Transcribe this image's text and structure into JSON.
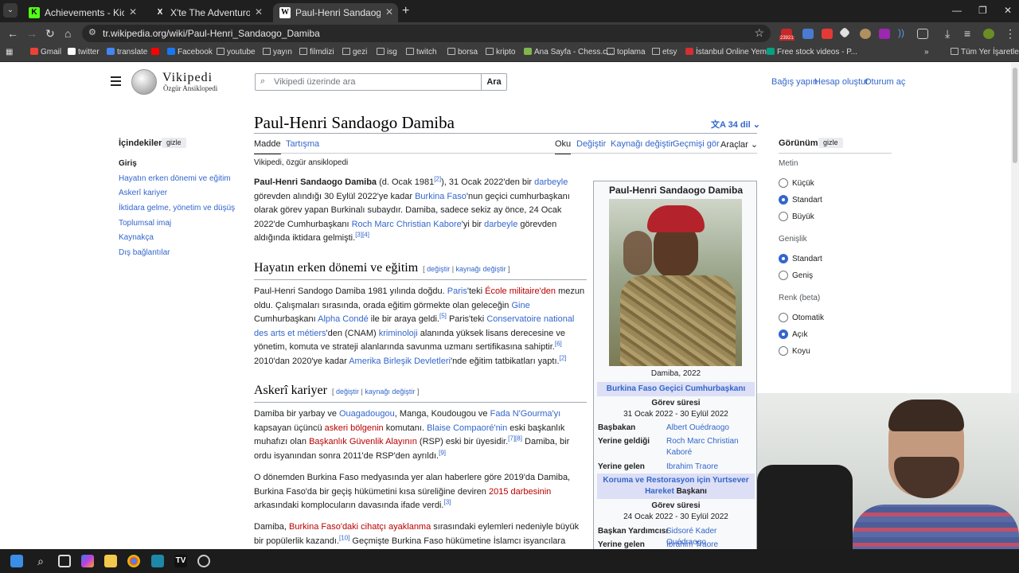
{
  "browser": {
    "tabs": [
      {
        "title": "Achievements - Kick Dashboard",
        "icon": "K",
        "icon_color": "#53fc18"
      },
      {
        "title": "X'te The Adventurous Soul: \"Ib...",
        "icon": "X",
        "icon_color": "#ffffff"
      },
      {
        "title": "Paul-Henri Sandaogo Damiba -",
        "icon": "W",
        "icon_color": "#ffffff"
      }
    ],
    "url": "tr.wikipedia.org/wiki/Paul-Henri_Sandaogo_Damiba",
    "bookmarks": [
      "Gmail",
      "twitter",
      "translate",
      "Facebook",
      "youtube",
      "yayın",
      "filmdizi",
      "gezi",
      "isg",
      "twitch",
      "borsa",
      "kripto",
      "Ana Sayfa - Chess.c...",
      "toplama",
      "etsy",
      "İstanbul Online Yem...",
      "Free stock videos - P..."
    ],
    "other_bookmarks": "Tüm Yer İşaretleri",
    "badge": "23921"
  },
  "wiki": {
    "logo_title": "Vikipedi",
    "logo_tagline": "Özgür Ansiklopedi",
    "search_placeholder": "Vikipedi üzerinde ara",
    "search_button": "Ara",
    "top_links": [
      "Bağış yapın",
      "Hesap oluştur",
      "Oturum aç"
    ],
    "title": "Paul-Henri Sandaogo Damiba",
    "languages": "34 dil",
    "page_tabs": [
      "Madde",
      "Tartışma"
    ],
    "view_tabs": [
      "Oku",
      "Değiştir",
      "Kaynağı değiştir",
      "Geçmişi gör",
      "Araçlar"
    ],
    "tagline": "Vikipedi, özgür ansiklopedi",
    "toc": {
      "heading": "İçindekiler",
      "hide": "gizle",
      "items": [
        "Giriş",
        "Hayatın erken dönemi ve eğitim",
        "Askerî kariyer",
        "İktidara gelme, yönetim ve düşüş",
        "Toplumsal imaj",
        "Kaynakça",
        "Dış bağlantılar"
      ]
    },
    "section_edit": [
      "değiştir",
      "kaynağı değiştir"
    ],
    "sections": {
      "early": "Hayatın erken dönemi ve eğitim",
      "military": "Askerî kariyer"
    },
    "infobox": {
      "title": "Paul-Henri Sandaogo Damiba",
      "caption": "Damiba, 2022",
      "office1": "Burkina Faso Geçici Cumhurbaşkanı",
      "term_label": "Görev süresi",
      "term1": "31 Ocak 2022 - 30 Eylül 2022",
      "rows1": [
        {
          "label": "Başbakan",
          "value": "Albert Ouédraogo"
        },
        {
          "label": "Yerine geldiği",
          "value": "Roch Marc Christian Kaboré"
        },
        {
          "label": "Yerine gelen",
          "value": "Ibrahim Traore"
        }
      ],
      "office2": "Koruma ve Restorasyon için Yurtsever Hareket",
      "office2_suffix": "Başkanı",
      "term2": "24 Ocak 2022 - 30 Eylül 2022",
      "rows2": [
        {
          "label": "Başkan Yardımcısı",
          "value": "Sidsoré Kader Ouédraogo"
        },
        {
          "label": "Yerine gelen",
          "value": "Ibrahim Traore"
        }
      ]
    },
    "appearance": {
      "heading": "Görünüm",
      "hide": "gizle",
      "text_label": "Metin",
      "text_options": [
        "Küçük",
        "Standart",
        "Büyük"
      ],
      "width_label": "Genişlik",
      "width_options": [
        "Standart",
        "Geniş"
      ],
      "color_label": "Renk (beta)",
      "color_options": [
        "Otomatik",
        "Açık",
        "Koyu"
      ]
    }
  }
}
